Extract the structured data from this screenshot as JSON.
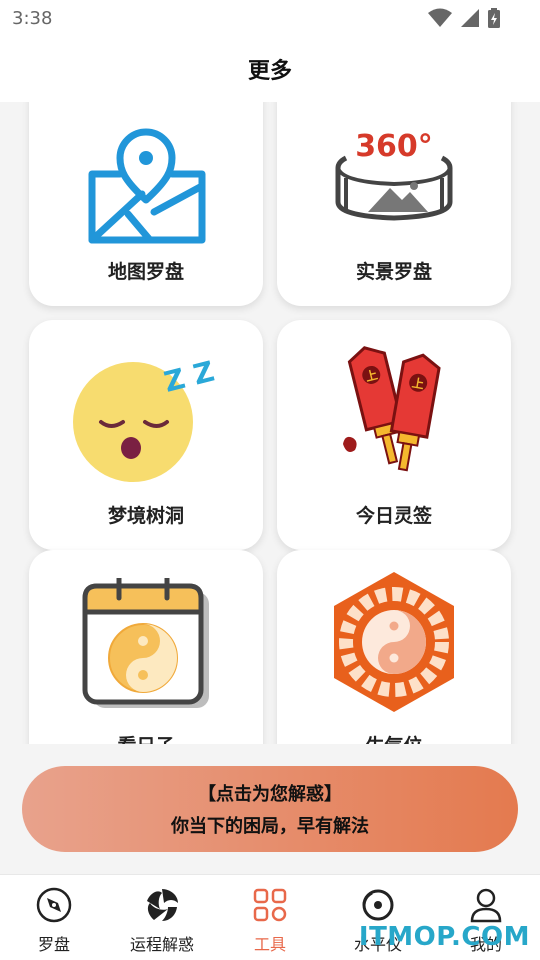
{
  "status_bar": {
    "time": "3:38"
  },
  "header": {
    "title": "更多"
  },
  "tools": [
    {
      "label": "地图罗盘",
      "icon": "map-location-icon"
    },
    {
      "label": "实景罗盘",
      "icon": "panorama-360-icon",
      "icon_text": "360°"
    },
    {
      "label": "梦境树洞",
      "icon": "sleeping-face-icon",
      "icon_text": "Z Z Z"
    },
    {
      "label": "今日灵签",
      "icon": "fortune-sticks-icon"
    },
    {
      "label": "看日子",
      "icon": "calendar-yinyang-icon"
    },
    {
      "label": "生气位",
      "icon": "bagua-icon"
    }
  ],
  "banner": {
    "line1": "【点击为您解惑】",
    "line2": "你当下的困局，早有解法"
  },
  "bottom_nav": [
    {
      "label": "罗盘",
      "icon": "compass-icon",
      "active": false
    },
    {
      "label": "运程解惑",
      "icon": "trefoil-icon",
      "active": false
    },
    {
      "label": "工具",
      "icon": "grid-tools-icon",
      "active": true
    },
    {
      "label": "水平仪",
      "icon": "level-icon",
      "active": false
    },
    {
      "label": "我的",
      "icon": "user-icon",
      "active": false
    }
  ],
  "watermark": "ITMOP.COM",
  "colors": {
    "accent": "#e8684a",
    "map_blue": "#2196d9",
    "banner_start": "#e8a28c",
    "banner_end": "#e47a4f"
  }
}
